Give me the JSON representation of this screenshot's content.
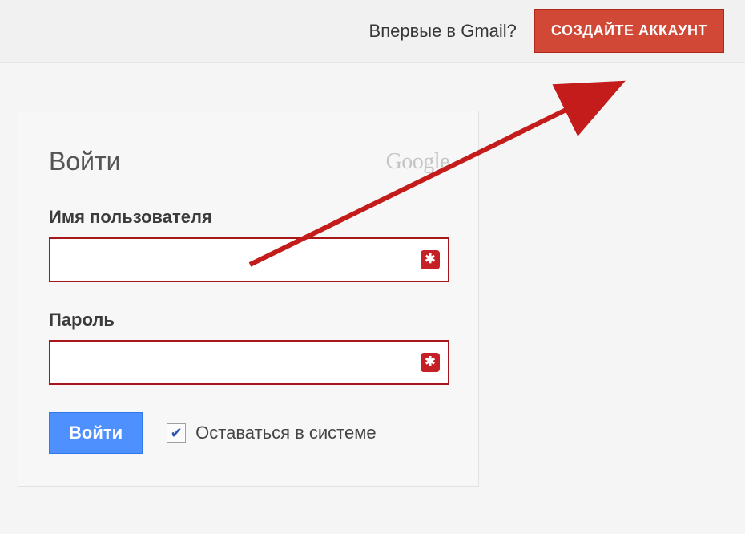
{
  "colors": {
    "accent_red": "#d14836",
    "accent_blue": "#4d90fe",
    "error_border": "#a6171c"
  },
  "header": {
    "prompt": "Впервые в Gmail?",
    "create_account_label": "СОЗДАЙТЕ АККАУНТ"
  },
  "login": {
    "title": "Войти",
    "brand": "Google",
    "username_label": "Имя пользователя",
    "username_value": "",
    "password_label": "Пароль",
    "password_value": "",
    "submit_label": "Войти",
    "stay_signed_label": "Оставаться в системе",
    "stay_signed_checked": true
  }
}
